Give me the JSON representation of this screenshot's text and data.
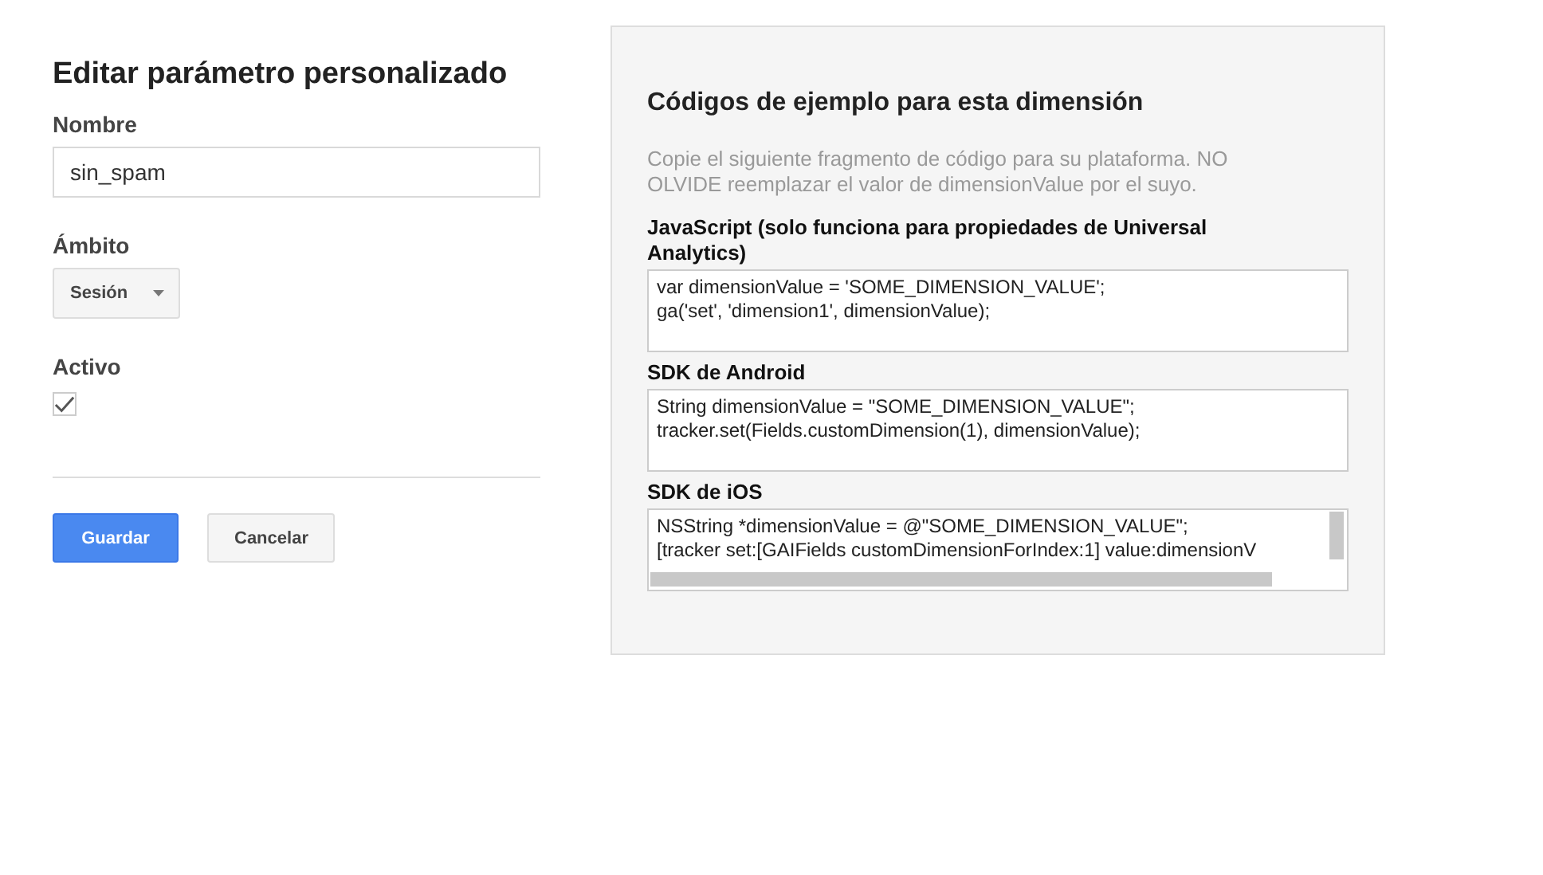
{
  "form": {
    "title": "Editar parámetro personalizado",
    "name_label": "Nombre",
    "name_value": "sin_spam",
    "scope_label": "Ámbito",
    "scope_value": "Sesión",
    "active_label": "Activo",
    "active_checked": true,
    "buttons": [
      {
        "kind": "primary",
        "label": "Guardar"
      },
      {
        "kind": "secondary",
        "label": "Cancelar"
      }
    ]
  },
  "samples": {
    "title": "Códigos de ejemplo para esta dimensión",
    "description": "Copie el siguiente fragmento de código para su plataforma. NO OLVIDE reemplazar el valor de dimensionValue por el suyo.",
    "snippets": [
      {
        "label": "JavaScript (solo funciona para propiedades de Universal Analytics)",
        "lines": [
          "var dimensionValue = 'SOME_DIMENSION_VALUE';",
          "ga('set', 'dimension1', dimensionValue);"
        ],
        "scrollbars": false
      },
      {
        "label": "SDK de Android",
        "lines": [
          "String dimensionValue = \"SOME_DIMENSION_VALUE\";",
          "tracker.set(Fields.customDimension(1), dimensionValue);"
        ],
        "scrollbars": false
      },
      {
        "label": "SDK de iOS",
        "lines": [
          "NSString *dimensionValue = @\"SOME_DIMENSION_VALUE\";",
          "[tracker set:[GAIFields customDimensionForIndex:1] value:dimensionV"
        ],
        "scrollbars": true
      }
    ]
  }
}
